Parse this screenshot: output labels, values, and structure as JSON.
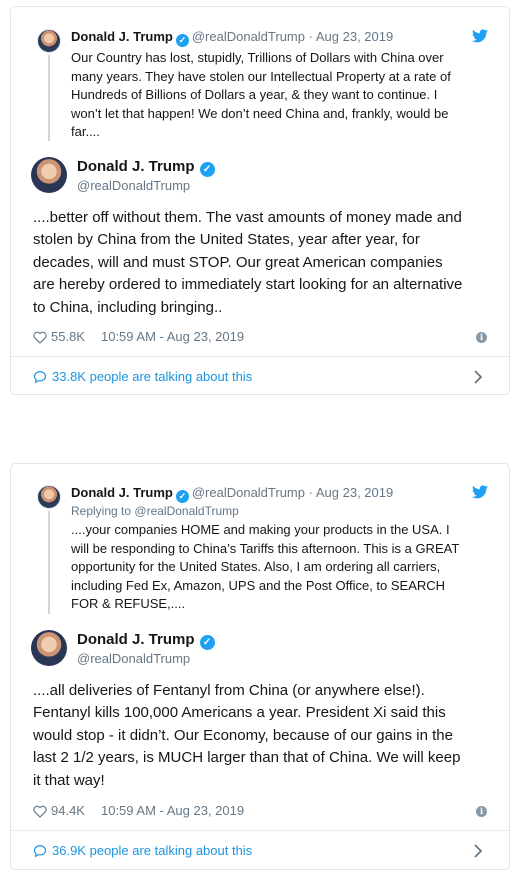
{
  "tweets": [
    {
      "parent": {
        "name": "Donald J. Trump",
        "handle": "@realDonaldTrump",
        "dot": "·",
        "date": "Aug 23, 2019",
        "replying": "",
        "text": "Our Country has lost, stupidly, Trillions of Dollars with China over\nmany years. They have stolen our Intellectual Property at a rate of\nHundreds of Billions of Dollars a year, & they want to continue. I\nwon’t let that happen! We don’t need China and, frankly, would be\nfar...."
      },
      "main": {
        "name": "Donald J. Trump",
        "handle": "@realDonaldTrump",
        "text": "....better off without them. The vast amounts of money made and\nstolen by China from the United States, year after year, for\ndecades, will and must STOP. Our great American companies\nare hereby ordered to immediately start looking for an alternative\nto China, including bringing..",
        "likes": "55.8K",
        "timestamp": "10:59 AM - Aug 23, 2019",
        "info_icon": "i",
        "talking": "33.8K people are talking about this"
      }
    },
    {
      "parent": {
        "name": "Donald J. Trump",
        "handle": "@realDonaldTrump",
        "dot": "·",
        "date": "Aug 23, 2019",
        "replying_prefix": "Replying to",
        "replying": "@realDonaldTrump",
        "text": "....your companies HOME and making your products in the USA. I\nwill be responding to China’s Tariffs this afternoon. This is a GREAT\nopportunity for the United States. Also, I am ordering all carriers,\nincluding Fed Ex, Amazon, UPS and the Post Office, to SEARCH\nFOR & REFUSE,...."
      },
      "main": {
        "name": "Donald J. Trump",
        "handle": "@realDonaldTrump",
        "text": "....all deliveries of Fentanyl from China (or anywhere else!).\nFentanyl kills 100,000 Americans a year. President Xi said this\nwould stop - it didn’t. Our Economy, because of our gains in the\nlast 2 1/2 years, is MUCH larger than that of China. We will keep\nit that way!",
        "likes": "94.4K",
        "timestamp": "10:59 AM - Aug 23, 2019",
        "info_icon": "i",
        "talking": "36.9K people are talking about this"
      }
    }
  ],
  "icons": {
    "verified": "✓",
    "verified_color": "#1da1f2",
    "link_color": "#1b95e0",
    "muted_color": "#657786"
  }
}
